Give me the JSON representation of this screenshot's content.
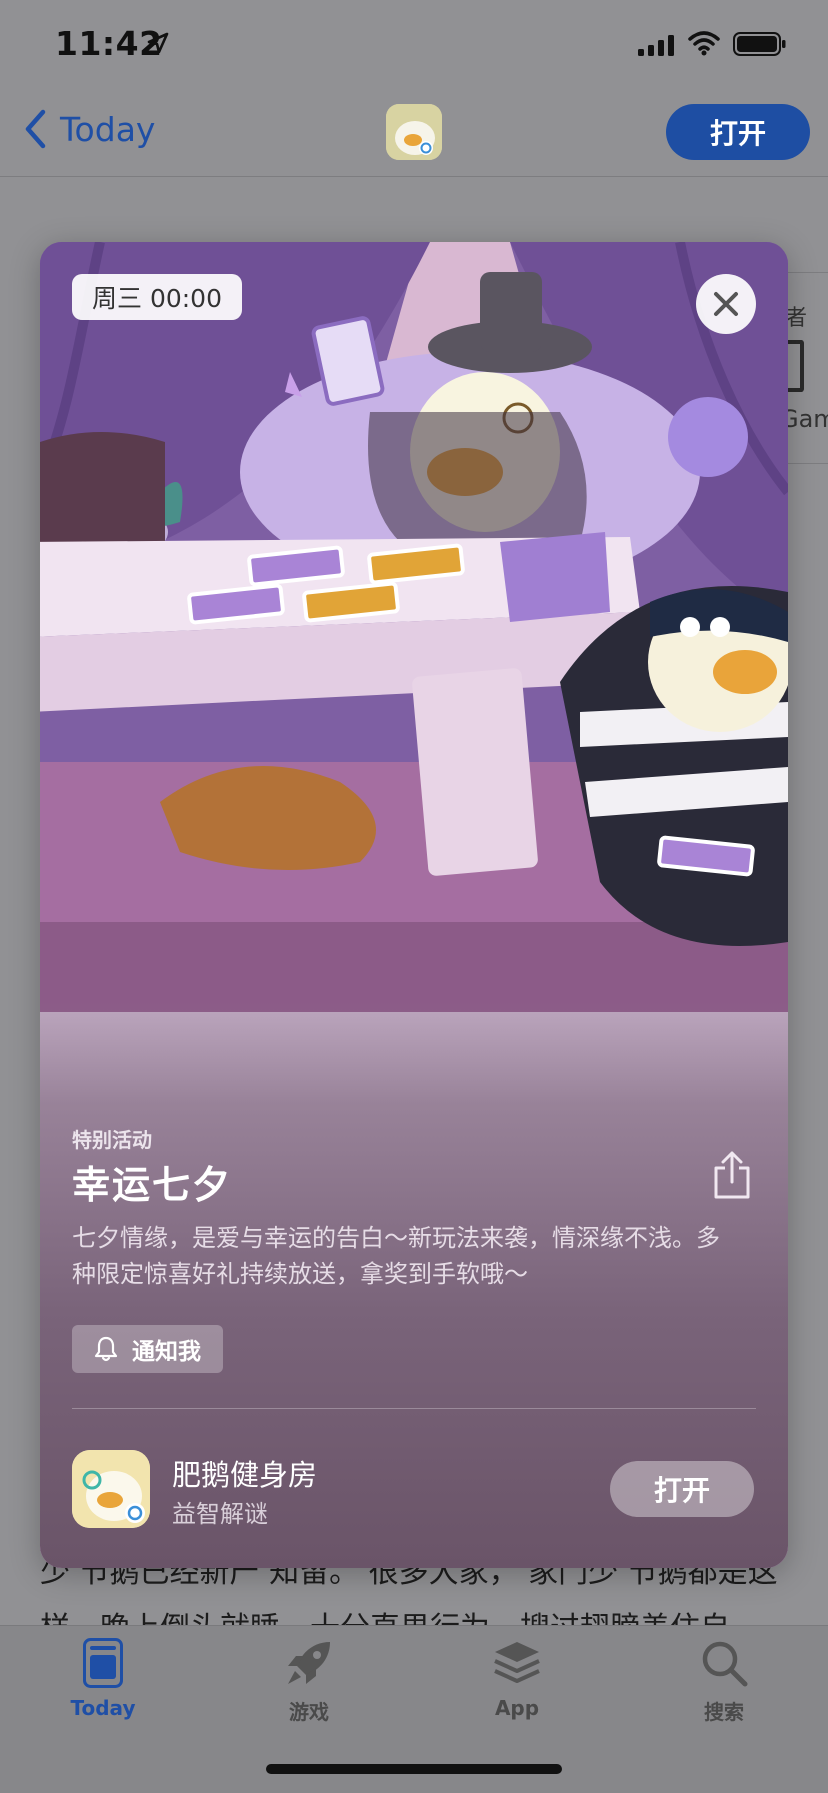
{
  "status": {
    "time": "11:42"
  },
  "nav": {
    "back_label": "Today",
    "open_label": "打开"
  },
  "behind": {
    "text1": "者",
    "text2": "Gam"
  },
  "background_article": {
    "line1": "少 节鹅已经新产 知留。 很多大家， 家门少 节鹅都是这",
    "line2": "样，晚上倒头就睡，十分直男行为。搜过翅膀盖住自"
  },
  "card": {
    "date_badge": "周三 00:00",
    "eyebrow": "特别活动",
    "title": "幸运七夕",
    "description": "七夕情缘，是爱与幸运的告白～新玩法来袭，情深缘不浅。多种限定惊喜好礼持续放送，拿奖到手软哦～",
    "notify_label": "通知我",
    "app_name": "肥鹅健身房",
    "app_subtitle": "益智解谜",
    "open_label": "打开"
  },
  "tabs": [
    {
      "label": "Today",
      "icon": "today-icon",
      "active": true
    },
    {
      "label": "游戏",
      "icon": "games-rocket-icon",
      "active": false
    },
    {
      "label": "App",
      "icon": "apps-stack-icon",
      "active": false
    },
    {
      "label": "搜索",
      "icon": "search-icon",
      "active": false
    }
  ],
  "colors": {
    "accent": "#1e4ea3",
    "card_bottom": "#6a5468"
  }
}
